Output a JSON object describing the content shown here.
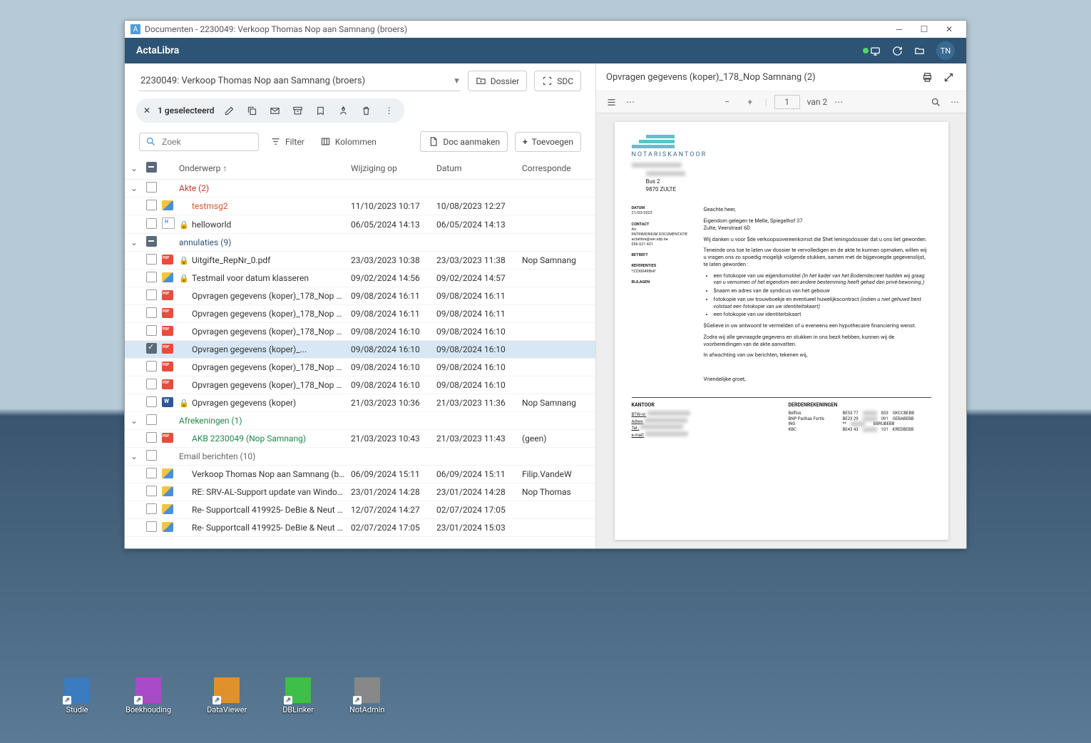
{
  "window_title": "Documenten - 2230049: Verkoop Thomas Nop aan Samnang (broers)",
  "brand": "ActaLibra",
  "user_initials": "TN",
  "dossier_select": "2230049: Verkoop Thomas Nop aan Samnang (broers)",
  "btn_dossier": "Dossier",
  "btn_sdc": "SDC",
  "selection_label": "1 geselecteerd",
  "search_placeholder": "Zoek",
  "btn_filter": "Filter",
  "btn_columns": "Kolommen",
  "btn_docmake": "Doc aanmaken",
  "btn_add": "Toevoegen",
  "columns": {
    "subject": "Onderwerp",
    "modified": "Wijziging op",
    "date": "Datum",
    "corr": "Corresponde"
  },
  "groups": [
    {
      "name": "Akte (2)",
      "cls": "grp-red",
      "rows": [
        {
          "icon": "mail",
          "lock": false,
          "subj": "testmsg2",
          "mod": "11/10/2023 10:17",
          "date": "10/08/2023 12:27",
          "corr": "",
          "subjcls": "txt-special"
        },
        {
          "icon": "html",
          "lock": true,
          "subj": "helloworld",
          "mod": "06/05/2024 14:13",
          "date": "06/05/2024 14:13",
          "corr": ""
        }
      ]
    },
    {
      "name": "annulaties (9)",
      "cls": "grp-blue",
      "ind": true,
      "rows": [
        {
          "icon": "pdf",
          "lock": true,
          "subj": "Uitgifte_RepNr_0.pdf",
          "mod": "23/03/2023 10:38",
          "date": "23/03/2023 11:38",
          "corr": "Nop Samnang"
        },
        {
          "icon": "mail",
          "lock": true,
          "subj": "Testmail voor datum klasseren",
          "mod": "09/02/2024 14:56",
          "date": "09/02/2024 14:57",
          "corr": ""
        },
        {
          "icon": "pdf",
          "lock": false,
          "subj": "Opvragen gegevens (koper)_178_Nop Samnan...",
          "mod": "09/08/2024 16:11",
          "date": "09/08/2024 16:11",
          "corr": ""
        },
        {
          "icon": "pdf",
          "lock": false,
          "subj": "Opvragen gegevens (koper)_178_Nop Samnan...",
          "mod": "09/08/2024 16:11",
          "date": "09/08/2024 16:11",
          "corr": ""
        },
        {
          "icon": "pdf",
          "lock": false,
          "subj": "Opvragen gegevens (koper)_178_Nop Samnan...",
          "mod": "09/08/2024 16:10",
          "date": "09/08/2024 16:10",
          "corr": ""
        },
        {
          "icon": "pdf",
          "lock": false,
          "subj": "Opvragen gegevens (koper)_...",
          "mod": "09/08/2024 16:10",
          "date": "09/08/2024 16:10",
          "corr": "",
          "sel": true
        },
        {
          "icon": "pdf",
          "lock": false,
          "subj": "Opvragen gegevens (koper)_178_Nop Samnan...",
          "mod": "09/08/2024 16:10",
          "date": "09/08/2024 16:10",
          "corr": ""
        },
        {
          "icon": "pdf",
          "lock": false,
          "subj": "Opvragen gegevens (koper)_178_Nop Samnang",
          "mod": "09/08/2024 16:10",
          "date": "09/08/2024 16:10",
          "corr": ""
        },
        {
          "icon": "word",
          "lock": true,
          "subj": "Opvragen gegevens (koper)",
          "mod": "21/03/2023 10:36",
          "date": "21/03/2023 11:36",
          "corr": "Nop Samnang"
        }
      ]
    },
    {
      "name": "Afrekeningen (1)",
      "cls": "grp-green",
      "rows": [
        {
          "icon": "pdf",
          "lock": false,
          "subj": "AKB 2230049 (Nop Samnang)",
          "mod": "21/03/2023 10:43",
          "date": "21/03/2023 11:43",
          "corr": "(geen)",
          "subjcls": "txt-green"
        }
      ]
    },
    {
      "name": "Email berichten (10)",
      "cls": "grp-gray",
      "rows": [
        {
          "icon": "mail",
          "lock": false,
          "subj": "Verkoop Thomas Nop aan Samnang (broers) (...",
          "mod": "06/09/2024 15:11",
          "date": "06/09/2024 15:11",
          "corr": "Filip.VandeW"
        },
        {
          "icon": "mail",
          "lock": false,
          "subj": "RE: SRV-AL-Support update van Windows 200...",
          "mod": "23/01/2024 14:28",
          "date": "23/01/2024 14:28",
          "corr": "Nop Thomas"
        },
        {
          "icon": "mail",
          "lock": false,
          "subj": "Re- Supportcall 419925- DeBie & Neut $ (Eker...",
          "mod": "12/07/2024 14:27",
          "date": "02/07/2024 17:05",
          "corr": ""
        },
        {
          "icon": "mail",
          "lock": false,
          "subj": "Re- Supportcall 419925- DeBie & Neut $ (Eker...",
          "mod": "02/07/2024 17:05",
          "date": "23/01/2024 15:03",
          "corr": ""
        }
      ]
    }
  ],
  "preview": {
    "title": "Opvragen gegevens (koper)_178_Nop Samnang (2)",
    "page": "1",
    "of_label": "van 2",
    "nk": "NOTARISKANTOOR",
    "addr1": "Bus 2",
    "addr2": "9870 ZULTE",
    "left": {
      "datum_h": "DATUM",
      "datum": "21/03/2023",
      "contact_h": "CONTACT",
      "contact1": "An",
      "contact2": "PATRIMONIUM DOCUMENTATIE",
      "contact3": "actalibra@ser.sdp.be",
      "contact4": "056 621 421",
      "betreft_h": "BETREFT",
      "ref_h": "REFERENTIES",
      "ref": "*2230049BnP",
      "bijlagen_h": "BIJLAGEN"
    },
    "body": {
      "aanhef": "Geachte heer,",
      "p1a": "Eigendom gelegen te Melle, Spiegelhof 37",
      "p1b": "Zulte, Veerstraat 6D",
      "p2": "Wij danken u voor $de verkoopsovereenkomst die $het leningsdossier dat u ons liet geworden.",
      "p3": "Teneinde ons toe te laten uw dossier te vervolledigen en de akte te kunnen opmaken, willen wij u vragen ons zo spoedig mogelijk volgende stukken, samen met de bijgevoegde gegevenslijst, te laten geworden :",
      "li1a": "een fotokopie van uw eigendomstitel ",
      "li1b": "(In het kader van het Bodemdecreet hadden wij graag van u vernomen of het eigendom een andere bestemming heeft gehad dan privé-bewoning.)",
      "li2": "$naam en adres van de syndicus van het gebouw",
      "li3a": "fotokopie van uw trouwboekje en eventueel huwelijkscontract ",
      "li3b": "(indien u niet gehuwd bent volstaat een fotokopie van uw identiteitskaart)",
      "li4": "een fotokopie van uw identiteitskaart",
      "p4": "$Gelieve in uw antwoord te vermelden of u eveneens een hypothecaire financiering wenst.",
      "p5": "Zodra wij alle gevraagde gegevens en stukken in ons bezit hebben, kunnen wij de voorbereidingen van de akte aanvatten.",
      "p6": "In afwachting van uw berichten, tekenen wij,",
      "p7": "Vriendelijke groet,"
    },
    "foot": {
      "kantoor_h": "KANTOOR",
      "k": [
        "BTW-nr:",
        "Adres:",
        "Tel.:",
        "e-mail:"
      ],
      "derden_h": "DERDENREKENINGEN",
      "banks": [
        {
          "n": "Belfius",
          "r": "BE53 77",
          "r2": "853",
          "c": "GKCCBEBB"
        },
        {
          "n": "BNP Paribas Fortis",
          "r": "BE23 29",
          "r2": "091",
          "c": "GEBABEBB"
        },
        {
          "n": "ING",
          "r": "**",
          "r2": "",
          "c": "BBRUBEBB"
        },
        {
          "n": "KBC",
          "r": "BE43 43",
          "r2": "101",
          "c": "KREDBEBB"
        }
      ]
    }
  },
  "desktop": [
    {
      "label": "Studie",
      "bg": "#3b7bbf"
    },
    {
      "label": "Boekhouding",
      "bg": "#a94bc9"
    },
    {
      "label": "DataViewer",
      "bg": "#e0912b"
    },
    {
      "label": "DBLinker",
      "bg": "#3dbf4a"
    },
    {
      "label": "NotAdmin",
      "bg": "#888"
    }
  ]
}
